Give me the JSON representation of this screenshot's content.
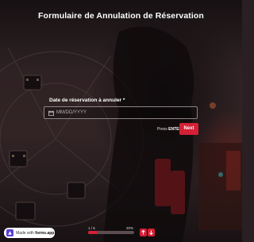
{
  "form": {
    "title": "Formulaire de Annulation de Réservation",
    "question_label": "Date de réservation à annuler *",
    "date_placeholder": "MM/DD/YYYY",
    "hint_prefix": "Press",
    "hint_key": "ENTER",
    "next_label": "Next"
  },
  "progress": {
    "count_text": "1 / 5",
    "percent_text": "20%",
    "fraction": 0.2
  },
  "badge": {
    "prefix": "Made with",
    "brand": "forms.app"
  },
  "icons": {
    "calendar": "calendar-icon",
    "up": "arrow-up-icon",
    "down": "arrow-down-icon",
    "logo": "formsapp-logo-icon"
  },
  "colors": {
    "accent": "#d32035",
    "field_border": "#8d8486"
  }
}
